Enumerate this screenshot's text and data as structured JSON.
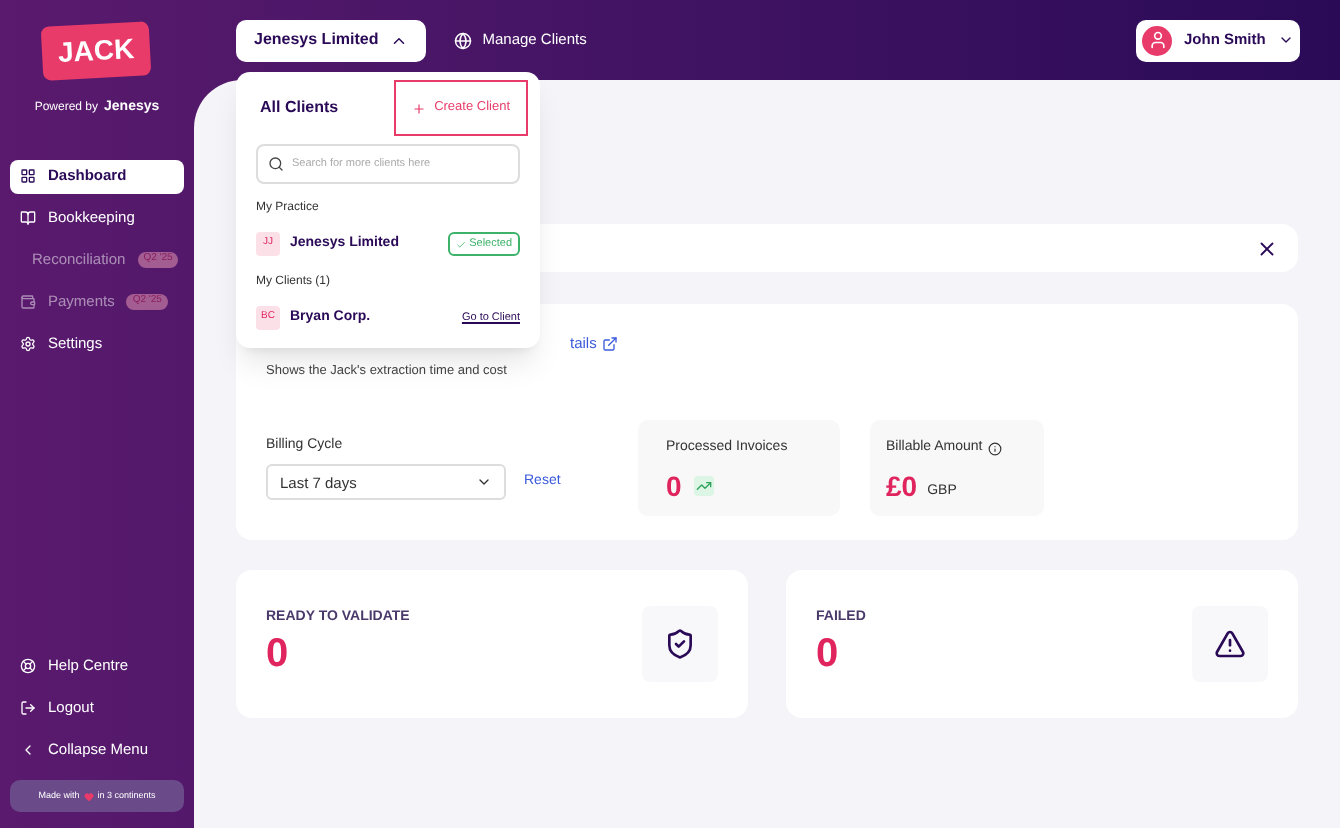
{
  "sidebar": {
    "logo": "JACK",
    "powered_by": "Powered by",
    "brand": "Jenesys",
    "items": [
      {
        "label": "Dashboard",
        "selected": true,
        "disabled": false
      },
      {
        "label": "Bookkeeping",
        "selected": false,
        "disabled": false
      },
      {
        "label": "Reconciliation",
        "selected": false,
        "disabled": true,
        "badge": "Q2 '25"
      },
      {
        "label": "Payments",
        "selected": false,
        "disabled": true,
        "badge": "Q2 '25"
      },
      {
        "label": "Settings",
        "selected": false,
        "disabled": false
      }
    ],
    "bottom_items": [
      {
        "label": "Help Centre"
      },
      {
        "label": "Logout"
      },
      {
        "label": "Collapse Menu"
      }
    ],
    "footer": {
      "before": "Made with",
      "after": "in 3 continents"
    }
  },
  "header": {
    "client": "Jenesys Limited",
    "expanded": true,
    "manage": "Manage Clients",
    "user": "John Smith"
  },
  "dropdown": {
    "title": "All Clients",
    "create": "Create Client",
    "search_placeholder": "Search for more clients here",
    "groups": [
      {
        "heading": "My Practice",
        "clients": [
          {
            "initials": "JJ",
            "name": "Jenesys Limited",
            "selected": true,
            "action": "Selected"
          }
        ]
      },
      {
        "heading": "My Clients (1)",
        "clients": [
          {
            "initials": "BC",
            "name": "Bryan Corp.",
            "selected": false,
            "action": "Go to Client"
          }
        ]
      }
    ]
  },
  "billing_card": {
    "link": "tails",
    "description": "Shows the Jack's extraction time and cost",
    "cycle_label": "Billing Cycle",
    "cycle_value": "Last 7 days",
    "reset": "Reset",
    "processed_label": "Processed Invoices",
    "processed_value": "0",
    "billable_label": "Billable Amount",
    "billable_value": "£0",
    "currency": "GBP"
  },
  "stat_cards": [
    {
      "label": "READY TO VALIDATE",
      "value": "0"
    },
    {
      "label": "FAILED",
      "value": "0"
    }
  ]
}
